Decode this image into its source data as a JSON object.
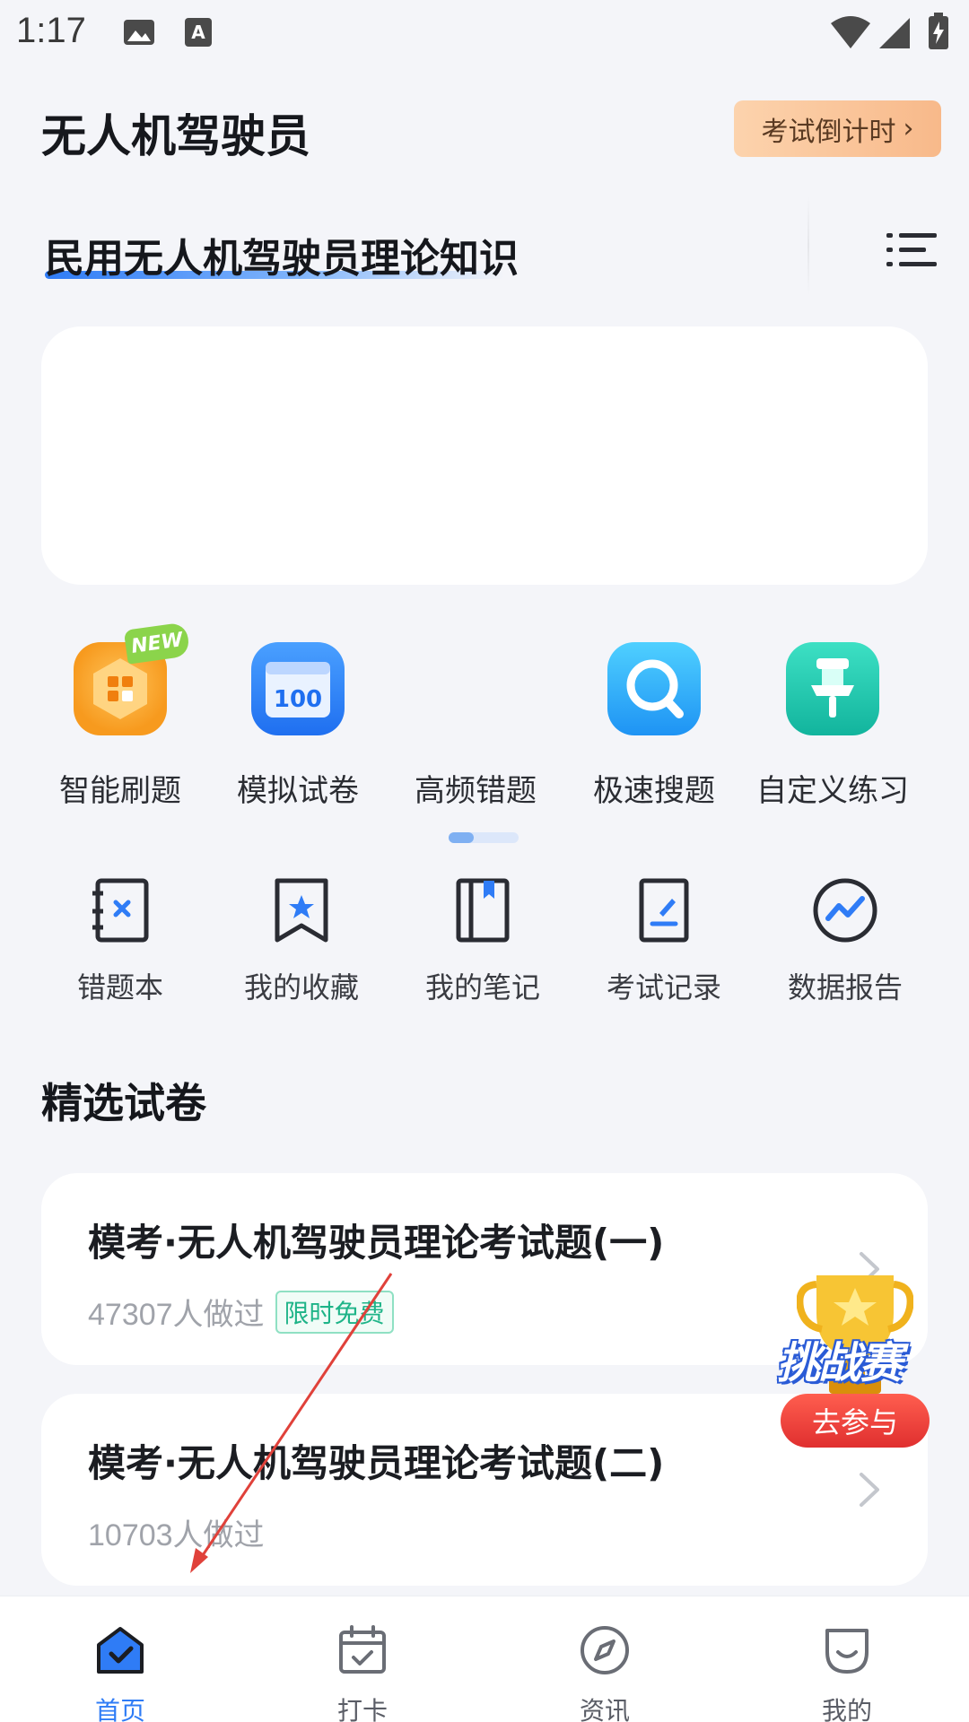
{
  "status_bar": {
    "time": "1:17"
  },
  "header": {
    "title": "无人机驾驶员",
    "countdown_label": "考试倒计时",
    "countdown_chevron": "›"
  },
  "subject": {
    "title": "民用无人机驾驶员理论知识"
  },
  "features": [
    {
      "label": "智能刷题",
      "icon": "smart-practice-icon",
      "color": "#f79a1e",
      "badge": "NEW"
    },
    {
      "label": "模拟试卷",
      "icon": "mock-exam-icon",
      "color": "#2e7df5",
      "number": "100"
    },
    {
      "label": "高频错题",
      "icon": "frequent-mistakes-icon",
      "color": "#f4f5f9"
    },
    {
      "label": "极速搜题",
      "icon": "quick-search-icon",
      "color": "#2aa8f5"
    },
    {
      "label": "自定义练习",
      "icon": "custom-practice-icon",
      "color": "#1ec9b0"
    }
  ],
  "page_indicator": {
    "pages": 2,
    "active": 1
  },
  "tools": [
    {
      "label": "错题本",
      "icon": "mistake-book-icon"
    },
    {
      "label": "我的收藏",
      "icon": "bookmark-icon"
    },
    {
      "label": "我的笔记",
      "icon": "notebook-icon"
    },
    {
      "label": "考试记录",
      "icon": "exam-record-icon"
    },
    {
      "label": "数据报告",
      "icon": "data-report-icon"
    }
  ],
  "section": {
    "title": "精选试卷"
  },
  "papers": [
    {
      "title": "模考·无人机驾驶员理论考试题(一)",
      "count": "47307人做过",
      "badge": "限时免费"
    },
    {
      "title": "模考·无人机驾驶员理论考试题(二)",
      "count": "10703人做过"
    }
  ],
  "challenge": {
    "word": "挑战赛",
    "button": "去参与"
  },
  "bottom_nav": [
    {
      "label": "首页",
      "icon": "home-icon",
      "active": true
    },
    {
      "label": "打卡",
      "icon": "calendar-check-icon",
      "active": false
    },
    {
      "label": "资讯",
      "icon": "compass-icon",
      "active": false
    },
    {
      "label": "我的",
      "icon": "profile-icon",
      "active": false
    }
  ],
  "colors": {
    "accent": "#2f7cf6",
    "background": "#f4f5f9",
    "free_badge": "#1fb488"
  }
}
